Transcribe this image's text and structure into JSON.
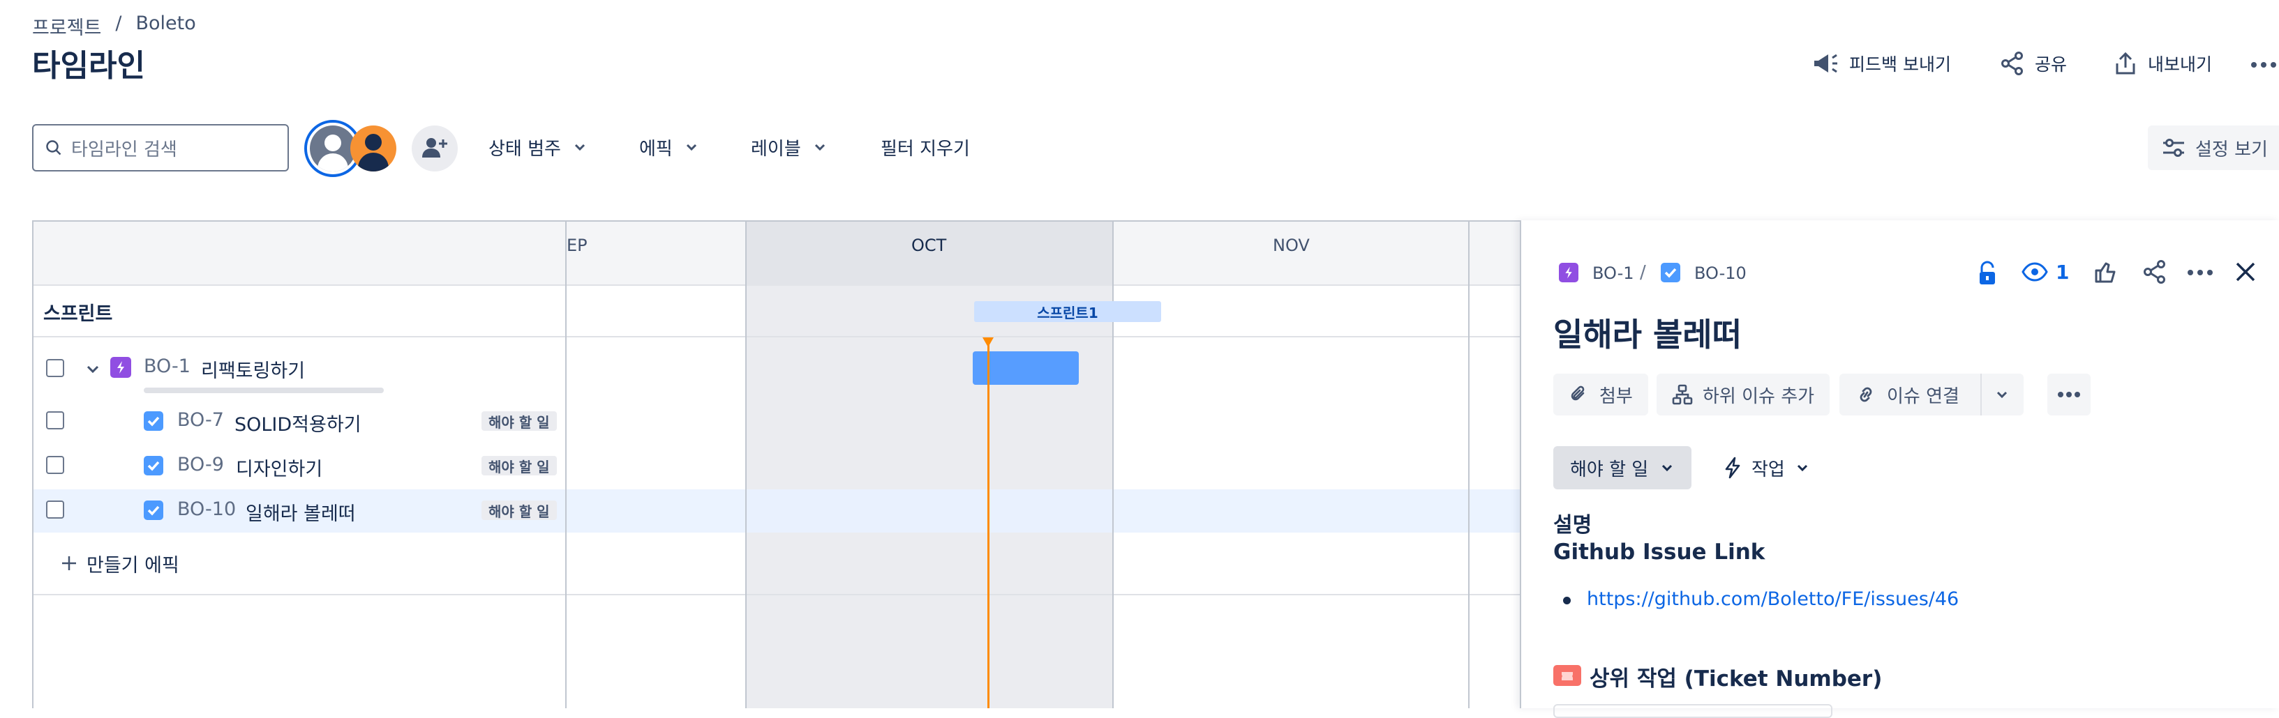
{
  "breadcrumb": {
    "root": "프로젝트",
    "separator": "/",
    "project": "Boleto"
  },
  "page_title": "타임라인",
  "header_actions": {
    "feedback": "피드백 보내기",
    "share": "공유",
    "export": "내보내기"
  },
  "toolbar": {
    "search_placeholder": "타임라인 검색",
    "status_category": "상태 범주",
    "epic": "에픽",
    "label": "레이블",
    "clear_filters": "필터 지우기",
    "view_settings": "설정 보기"
  },
  "timeline": {
    "months": [
      "EP",
      "OCT",
      "NOV"
    ],
    "sprint_row_label": "스프린트",
    "sprint_name": "스프린트1",
    "create_epic": "만들기 에픽",
    "issues": [
      {
        "key": "BO-1",
        "title": "리팩토링하기",
        "type": "epic",
        "status": ""
      },
      {
        "key": "BO-7",
        "title": "SOLID적용하기",
        "type": "task",
        "status": "해야 할 일"
      },
      {
        "key": "BO-9",
        "title": "디자인하기",
        "type": "task",
        "status": "해야 할 일"
      },
      {
        "key": "BO-10",
        "title": "일해라 볼레떠",
        "type": "task",
        "status": "해야 할 일"
      }
    ]
  },
  "detail": {
    "parent_key": "BO-1",
    "separator": "/",
    "issue_key": "BO-10",
    "watchers": "1",
    "title": "일해라 볼레떠",
    "buttons": {
      "attach": "첨부",
      "add_child": "하위 이슈 추가",
      "link_issue": "이슈 연결"
    },
    "status": "해야 할 일",
    "action": "작업",
    "description_heading": "설명",
    "description_subheading": "Github Issue Link",
    "link": "https://github.com/Boletto/FE/issues/46",
    "parent_section": "상위 작업 (Ticket Number)"
  },
  "colors": {
    "epic": "#904ee2",
    "task": "#4c9aff",
    "today": "#ff8b00",
    "selected_row": "#e9f2ff",
    "bar": "#579dff"
  }
}
